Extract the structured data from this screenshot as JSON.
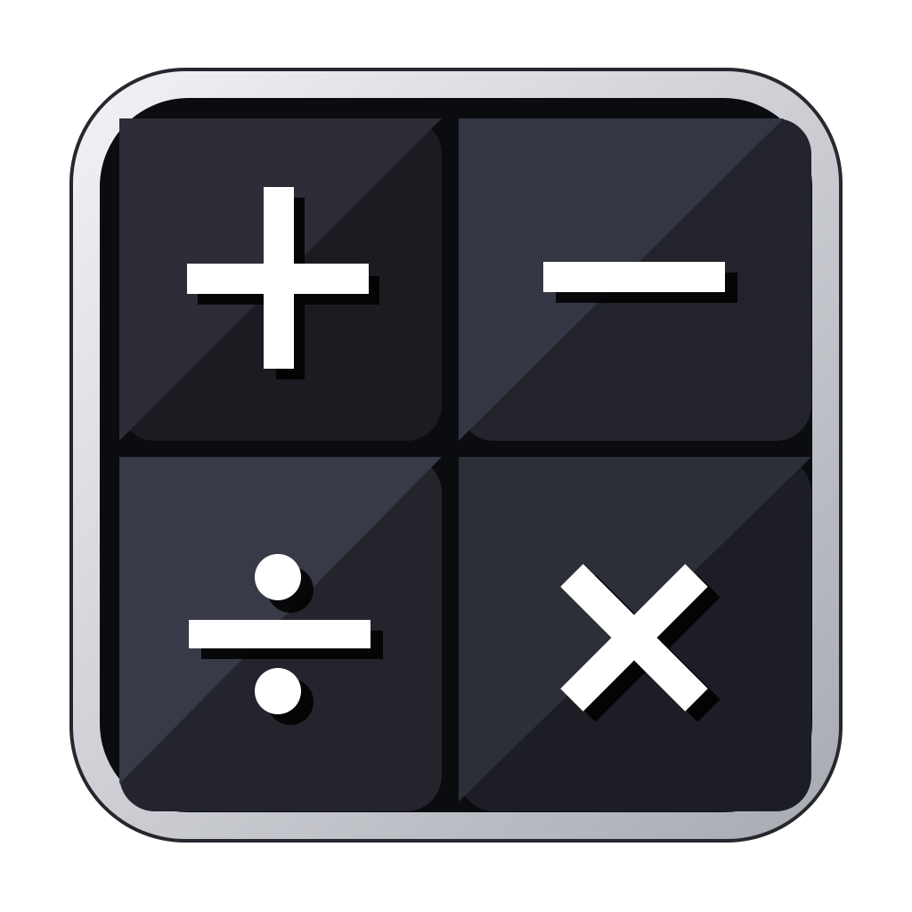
{
  "app_icon": {
    "name": "calculator",
    "frame_colors": {
      "outline": "#26282e",
      "metal_light": "#f2f3f6",
      "metal_mid": "#c9cbd1",
      "metal_dark": "#a8aab2",
      "face": "#0b0c10"
    },
    "tiles": [
      {
        "name": "plus",
        "icon": "plus-icon",
        "base": "#1b1c22",
        "sheen": "#2c2d37"
      },
      {
        "name": "minus",
        "icon": "minus-icon",
        "base": "#22232b",
        "sheen": "#353644"
      },
      {
        "name": "divide",
        "icon": "divide-icon",
        "base": "#23242c",
        "sheen": "#383a48"
      },
      {
        "name": "multiply",
        "icon": "multiply-icon",
        "base": "#1d1e25",
        "sheen": "#2c2e38"
      }
    ],
    "glyph_color": "#ffffff",
    "glyph_shadow": "#000000"
  }
}
